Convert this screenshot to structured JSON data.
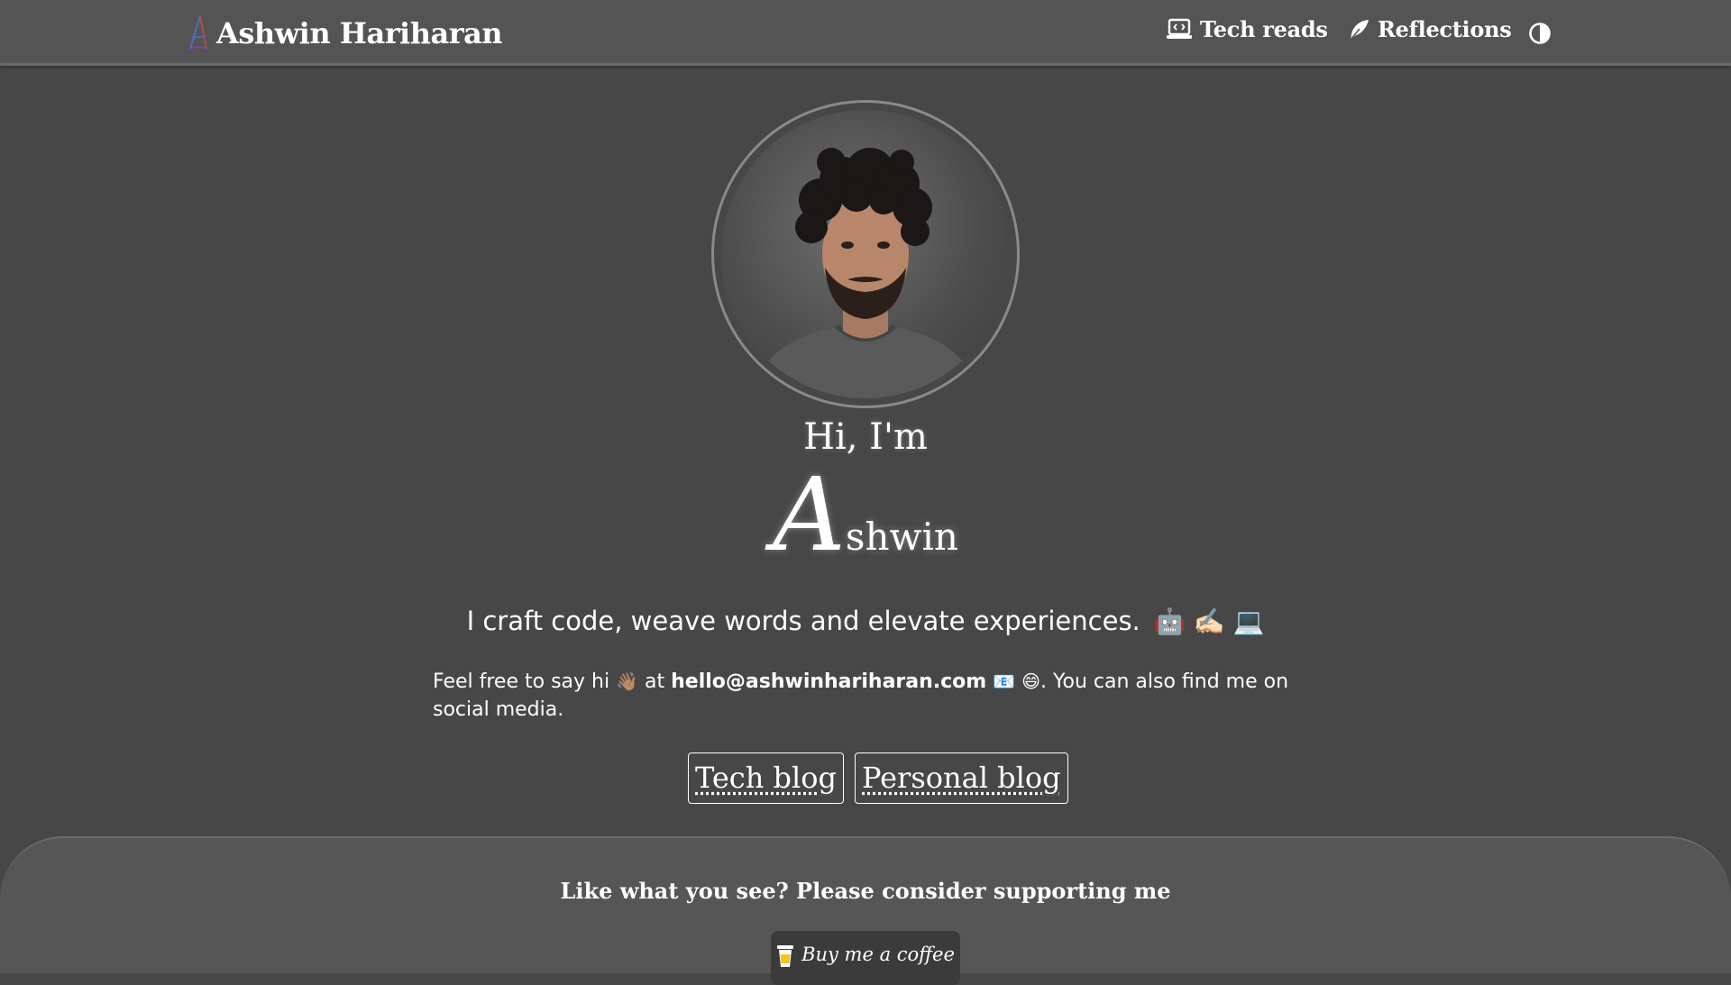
{
  "header": {
    "brand_name": "Ashwin Hariharan",
    "nav": [
      {
        "label": "Tech reads",
        "icon": "laptop-code-icon"
      },
      {
        "label": "Reflections",
        "icon": "feather-pen-icon"
      }
    ],
    "theme_toggle_icon": "half-circle-contrast-icon"
  },
  "hero": {
    "greeting": "Hi, I'm",
    "name_initial": "A",
    "name_rest": "shwin",
    "tagline": "I craft code, weave words and elevate experiences.",
    "tagline_emojis": "🤖 ✍🏻 💻",
    "contact": {
      "prefix": "Feel free to say hi",
      "wave_emoji": "👋🏽",
      "at": "at",
      "email": "hello@ashwinhariharan.com",
      "mail_emoji": "📧",
      "smile_emoji": "😄",
      "suffix": ". You can also find me on social media."
    },
    "buttons": {
      "tech_blog": "Tech blog",
      "personal_blog": "Personal blog"
    }
  },
  "footer": {
    "support_text": "Like what you see? Please consider supporting me",
    "coffee_label": "Buy me a coffee",
    "coffee_icon": "coffee-cup-icon"
  },
  "colors": {
    "background": "#474747",
    "header": "#545454",
    "footer": "#565656",
    "text": "#ffffff"
  }
}
